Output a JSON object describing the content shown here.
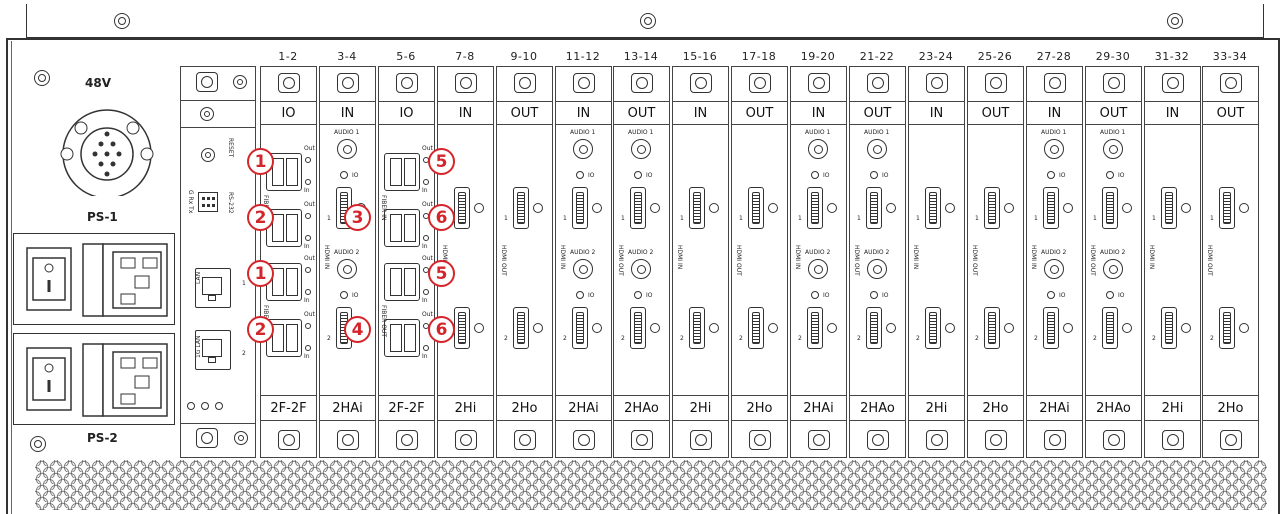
{
  "power": {
    "voltage_label": "48V",
    "ps1_label": "PS-1",
    "ps2_label": "PS-2"
  },
  "control_panel": {
    "reset_label": "RESET",
    "rs232_label": "RS-232",
    "rs232_pins_label": "G Rx Tx",
    "lan_label": "LAN",
    "lan2_label": "1G LAN",
    "lan_index_1": "1",
    "lan_index_2": "2"
  },
  "slots": [
    {
      "range": "1-2",
      "dir": "IO",
      "type": "2F-2F"
    },
    {
      "range": "3-4",
      "dir": "IN",
      "type": "2HAi"
    },
    {
      "range": "5-6",
      "dir": "IO",
      "type": "2F-2F"
    },
    {
      "range": "7-8",
      "dir": "IN",
      "type": "2Hi"
    },
    {
      "range": "9-10",
      "dir": "OUT",
      "type": "2Ho"
    },
    {
      "range": "11-12",
      "dir": "IN",
      "type": "2HAi"
    },
    {
      "range": "13-14",
      "dir": "OUT",
      "type": "2HAo"
    },
    {
      "range": "15-16",
      "dir": "IN",
      "type": "2Hi"
    },
    {
      "range": "17-18",
      "dir": "OUT",
      "type": "2Ho"
    },
    {
      "range": "19-20",
      "dir": "IN",
      "type": "2HAi"
    },
    {
      "range": "21-22",
      "dir": "OUT",
      "type": "2HAo"
    },
    {
      "range": "23-24",
      "dir": "IN",
      "type": "2Hi"
    },
    {
      "range": "25-26",
      "dir": "OUT",
      "type": "2Ho"
    },
    {
      "range": "27-28",
      "dir": "IN",
      "type": "2HAi"
    },
    {
      "range": "29-30",
      "dir": "OUT",
      "type": "2HAo"
    },
    {
      "range": "31-32",
      "dir": "IN",
      "type": "2Hi"
    },
    {
      "range": "33-34",
      "dir": "OUT",
      "type": "2Ho"
    }
  ],
  "port_labels": {
    "fiber_in": "FIBER IN",
    "fiber_out": "FIBER OUT",
    "hdmi_in": "HDMI IN",
    "hdmi_out": "HDMI OUT",
    "audio1": "AUDIO 1",
    "audio2": "AUDIO 2",
    "io": "IO",
    "out": "Out",
    "in": "In",
    "p1": "1",
    "p2": "2"
  },
  "callouts": {
    "c1a": "1",
    "c2a": "2",
    "c1b": "1",
    "c2b": "2",
    "c3": "3",
    "c4": "4",
    "c5a": "5",
    "c6a": "6",
    "c5b": "5",
    "c6b": "6"
  },
  "colors": {
    "callout": "#d4252b",
    "line": "#333333"
  }
}
